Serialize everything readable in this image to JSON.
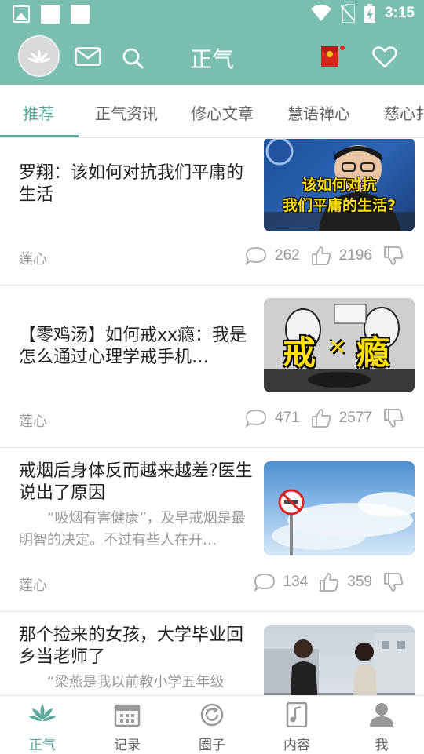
{
  "status_bar": {
    "time": "3:15",
    "left_icons": [
      "image-notification-icon",
      "blank-notification-icon",
      "blank-notification-icon"
    ],
    "right_icons": [
      "wifi-icon",
      "no-sim-icon",
      "battery-charging-icon"
    ]
  },
  "app_bar": {
    "title": "正气",
    "left_icons": [
      "avatar-lotus-icon",
      "mail-icon",
      "search-icon"
    ],
    "right_icons": [
      "red-envelope-icon",
      "heart-icon"
    ],
    "accent_color": "#7bbfb0"
  },
  "tabs": [
    {
      "label": "推荐",
      "active": true
    },
    {
      "label": "正气资讯",
      "active": false
    },
    {
      "label": "修心文章",
      "active": false
    },
    {
      "label": "慧语禅心",
      "active": false
    },
    {
      "label": "慈心扌",
      "active": false
    }
  ],
  "articles": [
    {
      "title": "罗翔：该如何对抗我们平庸的生活",
      "snippet": "",
      "source": "莲心",
      "comments": "262",
      "likes": "2196",
      "thumb_caption_1": "该如何对抗",
      "thumb_caption_2": "我们平庸的生活?"
    },
    {
      "title": "【零鸡汤】如何戒xx瘾：我是怎么通过心理学戒手机…",
      "snippet": "",
      "source": "莲心",
      "comments": "471",
      "likes": "2577",
      "thumb_caption_1": "戒",
      "thumb_caption_2": "瘾"
    },
    {
      "title": "戒烟后身体反而越来越差?医生说出了原因",
      "snippet": "“吸烟有害健康”，及早戒烟是最明智的决定。不过有些人在开…",
      "source": "莲心",
      "comments": "134",
      "likes": "359"
    },
    {
      "title": "那个捡来的女孩，大学毕业回乡当老师了",
      "snippet": "“梁燕是我以前教小学五年级",
      "source": "",
      "comments": "",
      "likes": ""
    }
  ],
  "bottom_nav": [
    {
      "label": "正气",
      "icon": "lotus-icon",
      "active": true
    },
    {
      "label": "记录",
      "icon": "calendar-icon",
      "active": false
    },
    {
      "label": "圈子",
      "icon": "circle-refresh-icon",
      "active": false
    },
    {
      "label": "内容",
      "icon": "music-note-icon",
      "active": false
    },
    {
      "label": "我",
      "icon": "person-icon",
      "active": false
    }
  ]
}
